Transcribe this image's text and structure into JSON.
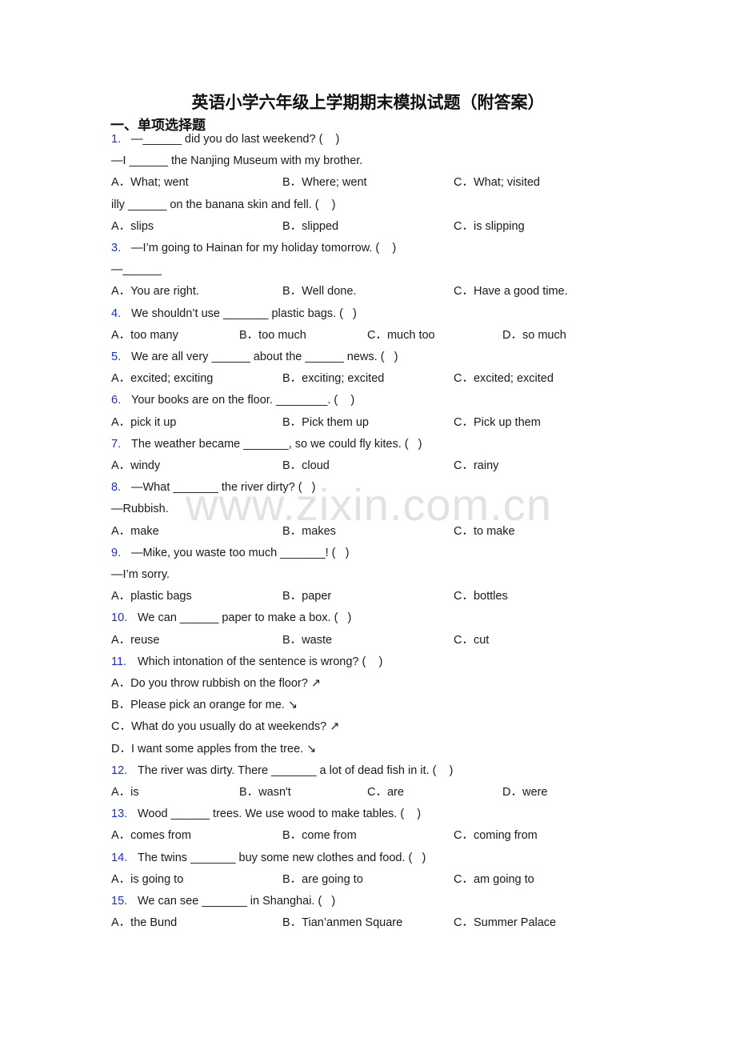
{
  "title": "英语小学六年级上学期期末模拟试题（附答案）",
  "section": "一、单项选择题",
  "watermark": "www.zixin.com.cn",
  "questions": [
    {
      "num": "1.",
      "stem": "—______ did you do last weekend? (    )",
      "extra": [
        "—I ______ the Nanjing Museum with my brother."
      ],
      "options": [
        "A．What; went",
        "B．Where; went",
        "C．What; visited"
      ]
    },
    {
      "num": "",
      "stem": "illy ______ on the banana skin and fell. (    )",
      "extra": [],
      "options": [
        "A．slips",
        "B．slipped",
        "C．is slipping"
      ]
    },
    {
      "num": "3.",
      "stem": "—I’m going to Hainan for my holiday tomorrow. (    )",
      "extra": [
        "—______"
      ],
      "options": [
        "A．You are right.",
        "B．Well done.",
        "C．Have a good time."
      ]
    },
    {
      "num": "4.",
      "stem": "We shouldn’t use _______ plastic bags. (   )",
      "extra": [],
      "options": [
        "A．too many",
        "B．too much",
        "C．much too",
        "D．so much"
      ]
    },
    {
      "num": "5.",
      "stem": "We are all very ______ about the ______ news. (   )",
      "extra": [],
      "options": [
        "A．excited; exciting",
        "B．exciting; excited",
        "C．excited; excited"
      ]
    },
    {
      "num": "6.",
      "stem": "Your books are on the floor. ________. (    )",
      "extra": [],
      "options": [
        "A．pick it up",
        "B．Pick them up",
        "C．Pick up them"
      ]
    },
    {
      "num": "7.",
      "stem": "The weather became _______, so we could fly kites. (   )",
      "extra": [],
      "options": [
        "A．windy",
        "B．cloud",
        "C．rainy"
      ]
    },
    {
      "num": "8.",
      "stem": "—What _______ the river dirty? (   )",
      "extra": [
        "—Rubbish."
      ],
      "options": [
        "A．make",
        "B．makes",
        "C．to make"
      ]
    },
    {
      "num": "9.",
      "stem": "—Mike, you waste too much _______! (   )",
      "extra": [
        "—I’m sorry."
      ],
      "options": [
        "A．plastic bags",
        "B．paper",
        "C．bottles"
      ]
    },
    {
      "num": "10.",
      "stem": "We can ______ paper to make a box. (   )",
      "extra": [],
      "options": [
        "A．reuse",
        "B．waste",
        "C．cut"
      ]
    },
    {
      "num": "11.",
      "stem": "Which intonation of the sentence is wrong? (    )",
      "extra": [],
      "options": [
        "A．Do you throw rubbish on the floor? ↗",
        "B．Please pick an orange for me. ↘",
        "C．What do you usually do at weekends? ↗",
        "D．I want some apples from the tree. ↘"
      ]
    },
    {
      "num": "12.",
      "stem": "The river was dirty. There _______ a lot of dead fish in it. (    )",
      "extra": [],
      "options": [
        "A．is",
        "B．wasn't",
        "C．are",
        "D．were"
      ]
    },
    {
      "num": "13.",
      "stem": "Wood ______ trees. We use wood to make tables. (    )",
      "extra": [],
      "options": [
        "A．comes from",
        "B．come from",
        "C．coming from"
      ]
    },
    {
      "num": "14.",
      "stem": "The twins _______ buy some new clothes and food. (   )",
      "extra": [],
      "options": [
        "A．is going to",
        "B．are going to",
        "C．am going to"
      ]
    },
    {
      "num": "15.",
      "stem": "We can see _______ in Shanghai. (   )",
      "extra": [],
      "options": [
        "A．the Bund",
        "B．Tian’anmen Square",
        "C．Summer Palace"
      ]
    }
  ]
}
